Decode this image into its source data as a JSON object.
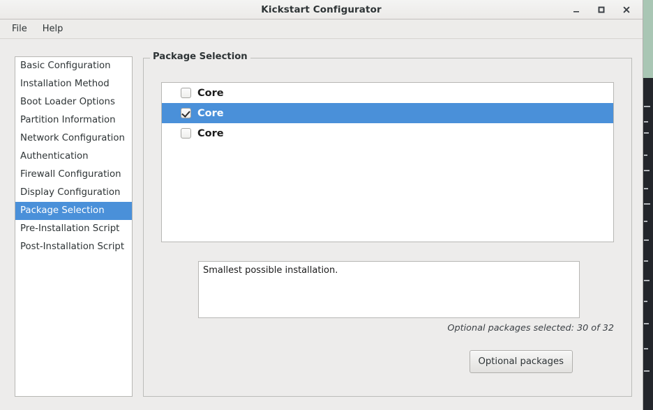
{
  "window": {
    "title": "Kickstart Configurator",
    "controls": [
      {
        "name": "minimize-button",
        "label": "–"
      },
      {
        "name": "maximize-button",
        "label": "□"
      },
      {
        "name": "close-button",
        "label": "✕"
      }
    ]
  },
  "menubar": {
    "items": [
      {
        "label": "File"
      },
      {
        "label": "Help"
      }
    ]
  },
  "sidebar": {
    "items": [
      {
        "label": "Basic Configuration",
        "selected": false
      },
      {
        "label": "Installation Method",
        "selected": false
      },
      {
        "label": "Boot Loader Options",
        "selected": false
      },
      {
        "label": "Partition Information",
        "selected": false
      },
      {
        "label": "Network Configuration",
        "selected": false
      },
      {
        "label": "Authentication",
        "selected": false
      },
      {
        "label": "Firewall Configuration",
        "selected": false
      },
      {
        "label": "Display Configuration",
        "selected": false
      },
      {
        "label": "Package Selection",
        "selected": true
      },
      {
        "label": "Pre-Installation Script",
        "selected": false
      },
      {
        "label": "Post-Installation Script",
        "selected": false
      }
    ]
  },
  "main": {
    "frame_label": "Package Selection",
    "package_rows": [
      {
        "label": "Core",
        "checked": false,
        "selected": false
      },
      {
        "label": "Core",
        "checked": true,
        "selected": true
      },
      {
        "label": "Core",
        "checked": false,
        "selected": false
      }
    ],
    "description": "Smallest possible installation.",
    "status": "Optional packages selected: 30 of 32",
    "optional_button": "Optional packages"
  },
  "colors": {
    "selection_blue": "#4a90d9",
    "window_bg": "#edeceb",
    "list_bg": "#ffffff",
    "text": "#2e3436",
    "border": "#b7b7b4",
    "desktop_green": "#a9c6b4",
    "terminal_bg": "#23262b"
  }
}
